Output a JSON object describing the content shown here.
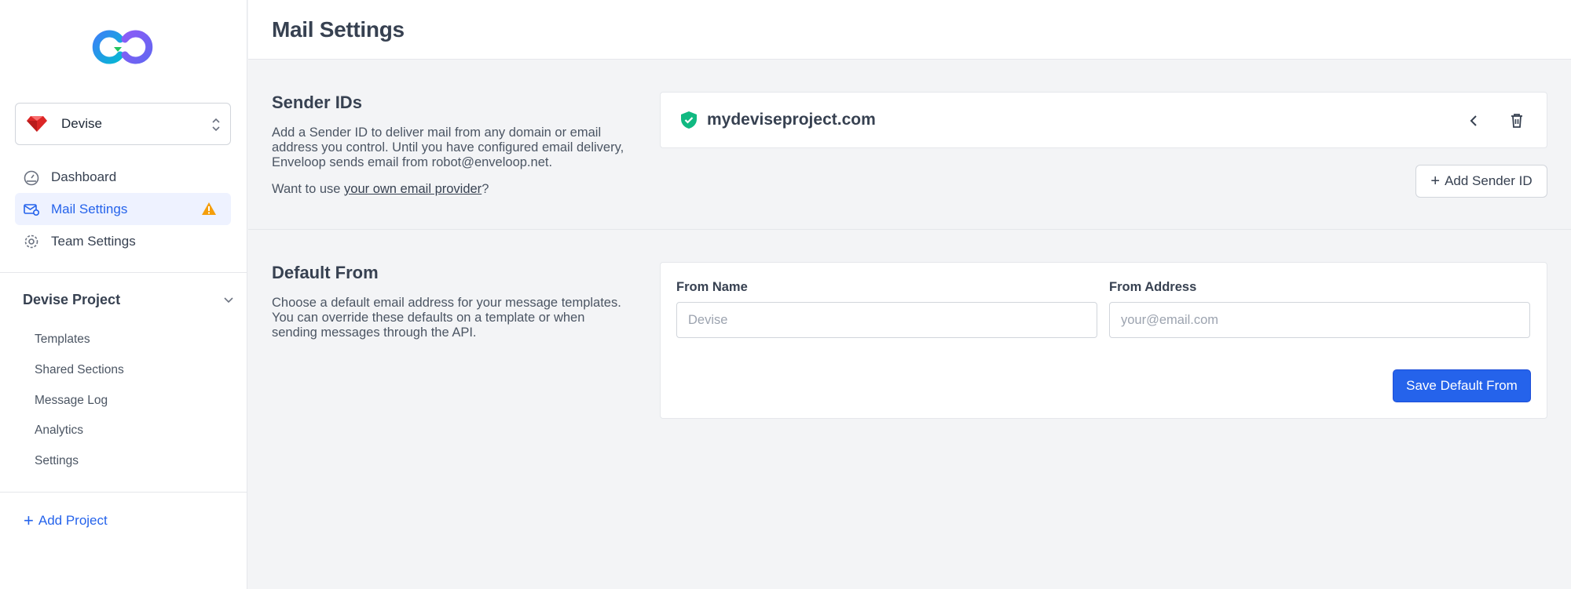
{
  "sidebar": {
    "team_selector": {
      "label": "Devise"
    },
    "nav": [
      {
        "label": "Dashboard",
        "icon": "dashboard-gauge-icon"
      },
      {
        "label": "Mail Settings",
        "icon": "mail-gear-icon",
        "active": true,
        "badge_icon": "warning-icon"
      },
      {
        "label": "Team Settings",
        "icon": "gear-icon"
      }
    ],
    "project": {
      "title": "Devise Project",
      "items": [
        "Templates",
        "Shared Sections",
        "Message Log",
        "Analytics",
        "Settings"
      ]
    },
    "add_project_label": "Add Project"
  },
  "header": {
    "title": "Mail Settings"
  },
  "sender_ids": {
    "title": "Sender IDs",
    "description": "Add a Sender ID to deliver mail from any domain or email address you control. Until you have configured email delivery, Enveloop sends email from robot@enveloop.net.",
    "provider_prefix": "Want to use ",
    "provider_link": "your own email provider",
    "provider_suffix": "?",
    "domains": [
      {
        "domain": "mydeviseproject.com",
        "verified": true
      }
    ],
    "add_button_label": "Add Sender ID"
  },
  "default_from": {
    "title": "Default From",
    "description": "Choose a default email address for your message templates. You can override these defaults on a template or when sending messages through the API.",
    "from_name": {
      "label": "From Name",
      "placeholder": "Devise",
      "value": ""
    },
    "from_address": {
      "label": "From Address",
      "placeholder": "your@email.com",
      "value": ""
    },
    "save_label": "Save Default From"
  },
  "colors": {
    "accent": "#2563eb",
    "active_bg": "#eef2ff",
    "warning": "#f59e0b",
    "verified": "#10b981"
  }
}
